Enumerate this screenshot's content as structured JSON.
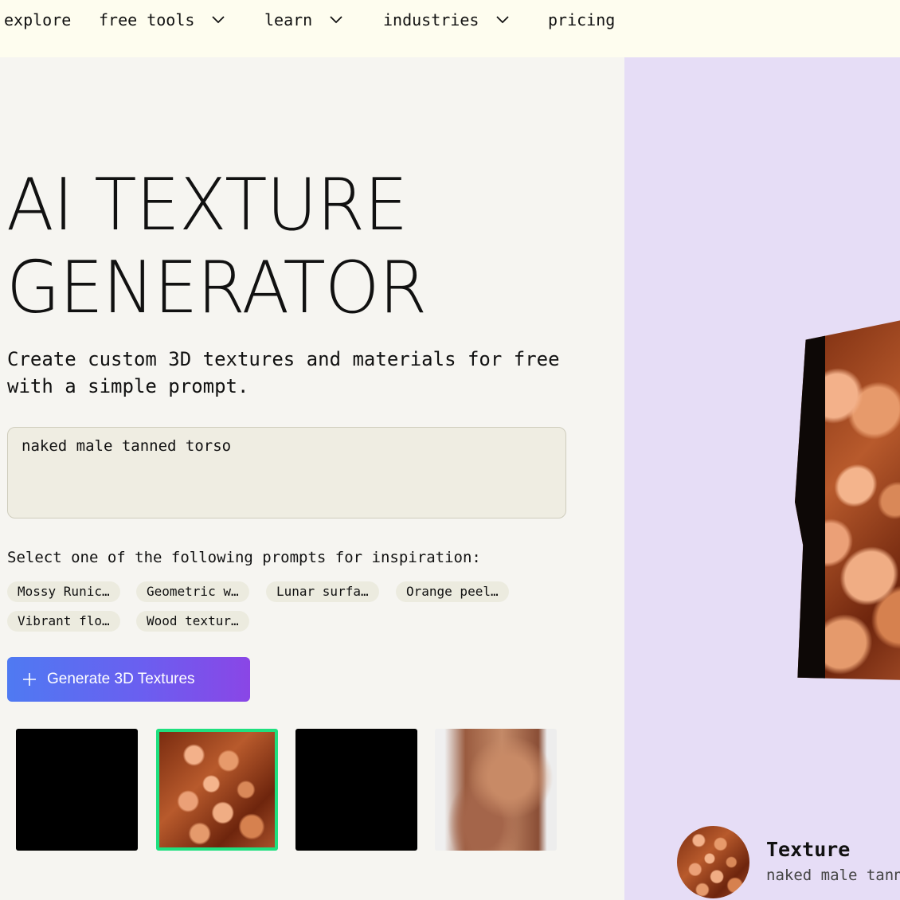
{
  "nav": {
    "items": [
      {
        "label": "explore",
        "has_dropdown": false
      },
      {
        "label": "free tools",
        "has_dropdown": true
      },
      {
        "label": "learn",
        "has_dropdown": true
      },
      {
        "label": "industries",
        "has_dropdown": true
      },
      {
        "label": "pricing",
        "has_dropdown": false
      }
    ]
  },
  "hero": {
    "title_line1": "AI TEXTURE",
    "title_line2": "GENERATOR",
    "subtitle": "Create custom 3D textures and materials for free with a simple prompt."
  },
  "prompt": {
    "value": "naked male tanned torso"
  },
  "inspiration": {
    "label": "Select one of the following prompts for inspiration:",
    "chips": [
      "Mossy Runic…",
      "Geometric w…",
      "Lunar surfa…",
      "Orange peel…",
      "Vibrant flo…",
      "Wood textur…"
    ]
  },
  "generate_button": {
    "label": "Generate 3D Textures",
    "icon": "plus-icon"
  },
  "results": {
    "thumbnails": [
      {
        "kind": "empty",
        "selected": false
      },
      {
        "kind": "texture",
        "selected": true
      },
      {
        "kind": "empty",
        "selected": false
      },
      {
        "kind": "render",
        "selected": false
      }
    ]
  },
  "preview": {
    "background": "#e6ddf6",
    "card_title": "Texture",
    "card_subtitle": "naked male tann"
  },
  "colors": {
    "nav_bg": "#fefdef",
    "page_bg": "#f6f5f1",
    "selected_border": "#1fe07f",
    "button_gradient_start": "#4f7af2",
    "button_gradient_end": "#8a46e6"
  }
}
